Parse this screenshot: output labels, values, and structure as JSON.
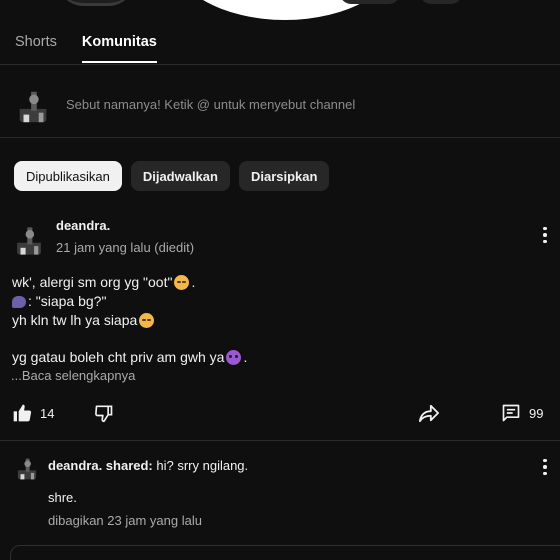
{
  "tabs": [
    {
      "label": "Shorts"
    },
    {
      "label": "Komunitas"
    }
  ],
  "composer": {
    "placeholder": "Sebut namanya! Ketik @ untuk menyebut channel"
  },
  "filters": [
    {
      "label": "Dipublikasikan",
      "selected": true
    },
    {
      "label": "Dijadwalkan"
    },
    {
      "label": "Diarsipkan"
    }
  ],
  "post": {
    "author": "deandra.",
    "time": "21 jam yang lalu (diedit)",
    "lines": {
      "l1": "wk', alergi sm org yg \"oot\"",
      "l1_end": ".",
      "l2": ": \"siapa bg?\"",
      "l3": "yh kln tw lh ya siapa",
      "l4": "yg gatau boleh cht priv am gwh ya",
      "l4_end": "."
    },
    "read_more": "...Baca selengkapnya",
    "likes": "14",
    "comments": "99"
  },
  "shared_post": {
    "author_shared": "deandra. shared:",
    "headline": " hi? srry ngilang.",
    "text": "shre.",
    "time": "dibagikan 23 jam yang lalu"
  },
  "icons": {
    "like": "thumbs-up-icon",
    "dislike": "thumbs-down-icon",
    "share": "share-icon",
    "comments": "comment-icon",
    "more": "more-vert-icon"
  },
  "colors": {
    "background": "#0f0f0f",
    "chip": "#272727",
    "chip_selected": "#f1f1f1",
    "text_secondary": "#aaaaaa"
  }
}
